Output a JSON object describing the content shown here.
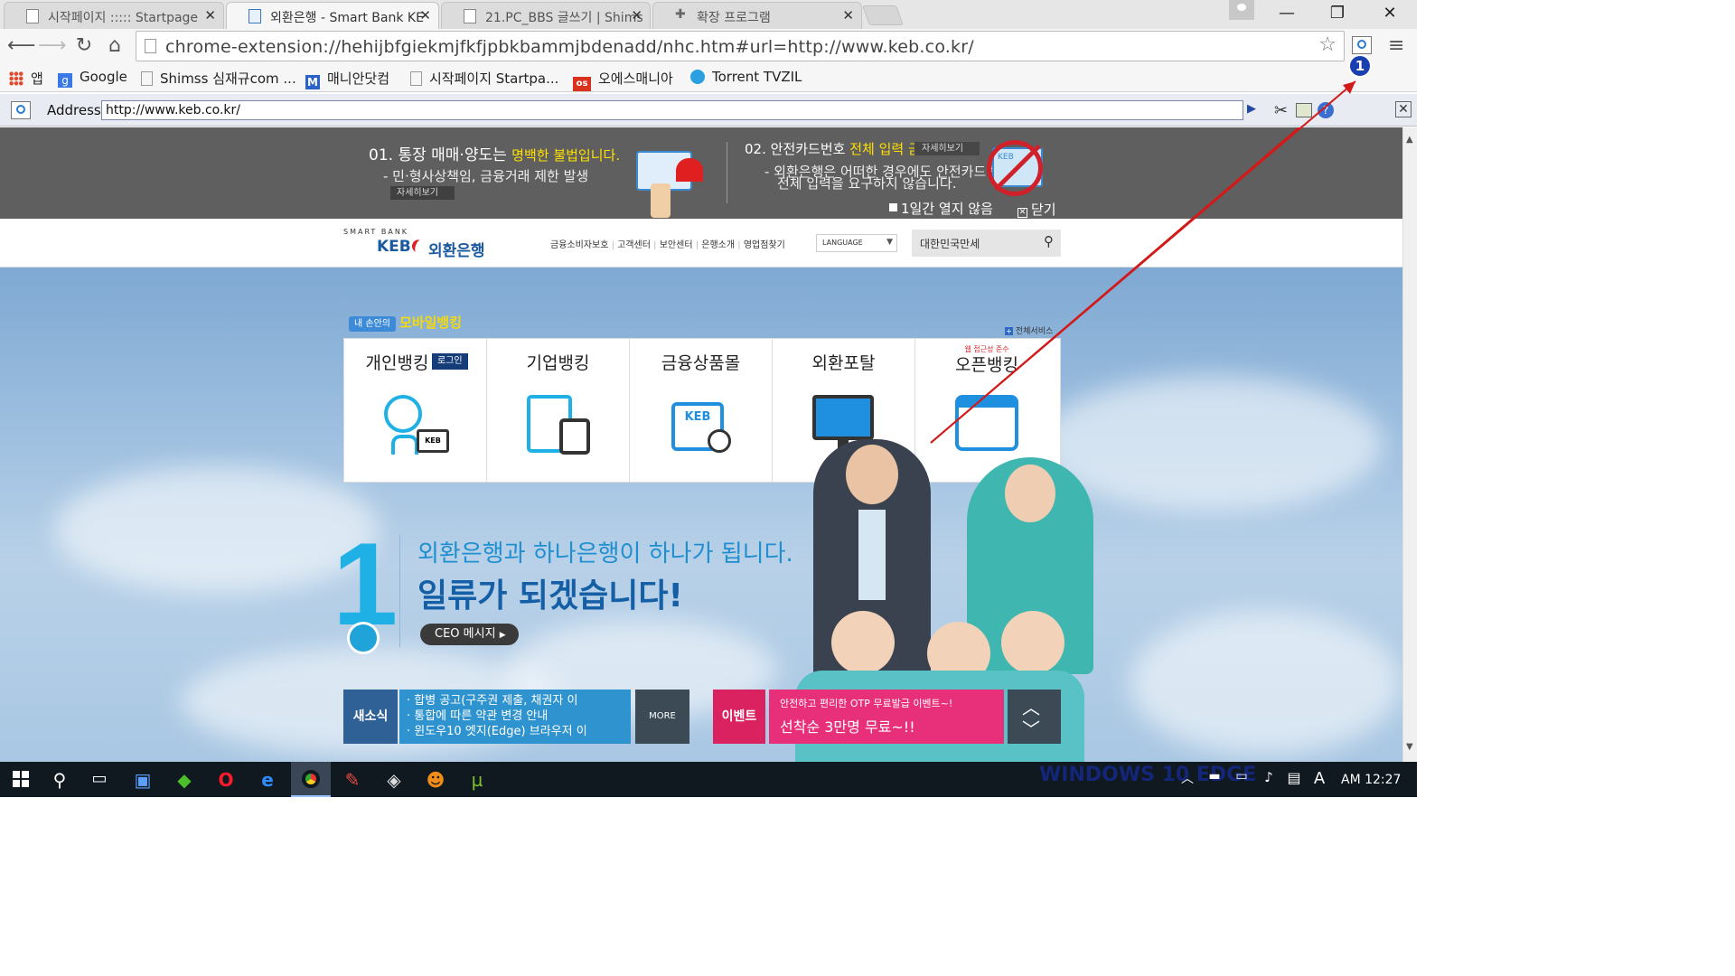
{
  "tabs": [
    {
      "title": "시작페이지 ::::: Startpage",
      "active": false
    },
    {
      "title": "외환은행 - Smart Bank KE",
      "active": true
    },
    {
      "title": "21.PC_BBS 글쓰기 | Shims",
      "active": false
    },
    {
      "title": "확장 프로그램",
      "active": false
    }
  ],
  "omnibox": {
    "url": "chrome-extension://hehijbfgiekmjfkfjpbkbammjbdenadd/nhc.htm#url=http://www.keb.co.kr/"
  },
  "bookmarks": [
    "앱",
    "Google",
    "Shimss 심재규com ...",
    "매니안닷컴",
    "시작페이지 Startpa...",
    "오에스매니아",
    "Torrent TVZIL"
  ],
  "badge": "1",
  "iebar": {
    "label": "Address:",
    "url": "http://www.keb.co.kr/"
  },
  "notice": {
    "n1_num": "01.",
    "n1_title": "통장 매매·양도는",
    "n1_highlight": "명백한 불법입니다.",
    "n1_sub": "- 민·형사상책임, 금융거래 제한 발생",
    "n1_more": "자세히보기",
    "n2_num": "02.",
    "n2_title": "안전카드번호",
    "n2_highlight": "전체 입력 금지",
    "n2_more": "자세히보기",
    "n2_sub1": "- 외환은행은 어떠한 경우에도 안전카드번호",
    "n2_sub2": "전체 입력을 요구하지 않습니다.",
    "hide_today": "1일간 열지 않음",
    "close": "닫기",
    "card_logo": "KEB"
  },
  "header": {
    "logo_small": "SMART BANK",
    "logo_keb": "KEB",
    "logo_name": "외환은행",
    "menu": [
      "금융소비자보호",
      "고객센터",
      "보안센터",
      "은행소개",
      "영업점찾기"
    ],
    "language": "LANGUAGE",
    "search_value": "대한민국만세"
  },
  "hero": {
    "mobile_badge": "내 손안의",
    "mobile_title": "모바일뱅킹",
    "all_services": "전체서비스",
    "cards": [
      {
        "label": "개인뱅킹",
        "tag": "로그인"
      },
      {
        "label": "기업뱅킹"
      },
      {
        "label": "금융상품몰"
      },
      {
        "label": "외환포탈"
      },
      {
        "label": "오픈뱅킹",
        "tag": "웹 접근성 준수"
      }
    ],
    "card_logo": "KEB",
    "big_number": "1",
    "headline1": "외환은행과 하나은행이 하나가 됩니다.",
    "headline2": "일류가 되겠습니다!",
    "ceo_button": "CEO 메시지",
    "news_label": "새소식",
    "news_items": [
      "· 합병 공고(구주권 제출, 채권자 이",
      "· 통합에 따른 약관 변경 안내",
      "· 윈도우10 엣지(Edge) 브라우저 이"
    ],
    "more": "MORE",
    "event_label": "이벤트",
    "event_line1": "안전하고 편리한 OTP 무료발급 이벤트~!",
    "event_line2": "선착순 3만명 무료~!!"
  },
  "taskbar": {
    "clock": "AM 12:27",
    "ime": "A",
    "overlay_text": "WINDOWS 10 EDGE"
  },
  "colors": {
    "keb_blue": "#1a5aa0",
    "sky_accent": "#1fb1e6",
    "event_pink": "#d9225f",
    "news_blue": "#2f6196"
  }
}
